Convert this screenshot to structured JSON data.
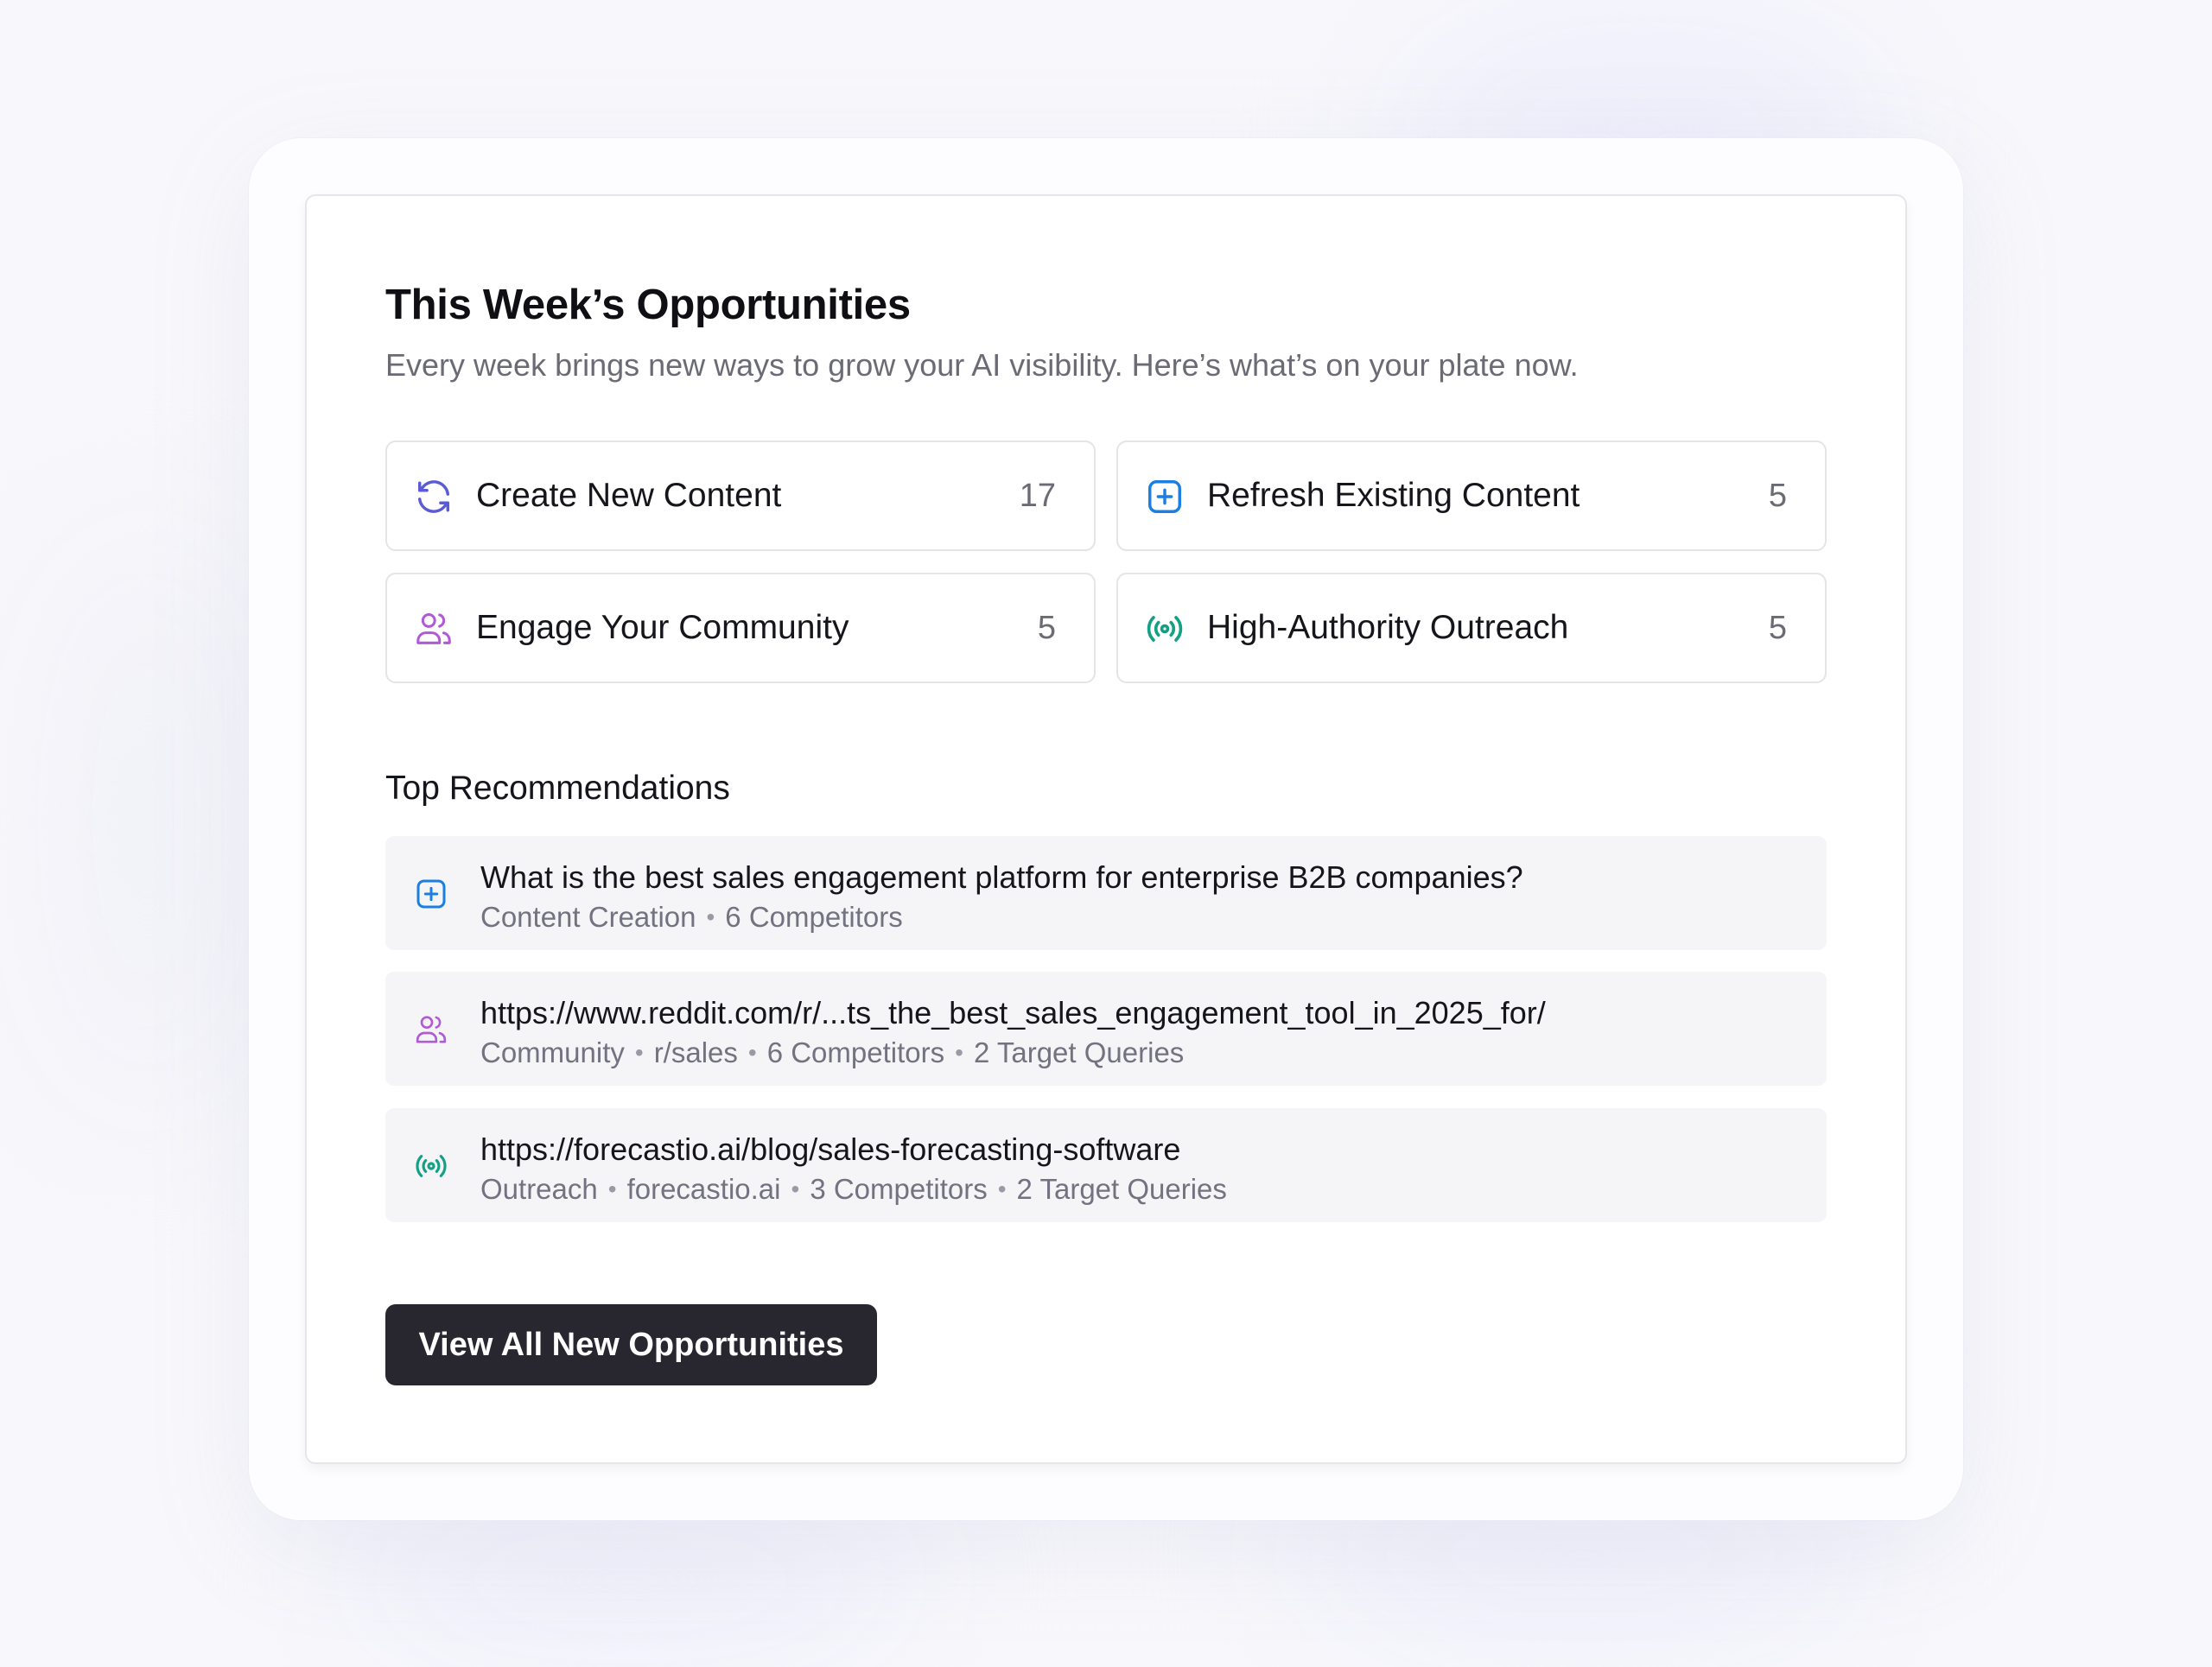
{
  "header": {
    "title": "This Week’s Opportunities",
    "subtitle": "Every week brings new ways to grow your AI visibility. Here’s what’s on your plate now."
  },
  "opportunities": [
    {
      "label": "Create New Content",
      "count": "17",
      "icon": "refresh-cycle-icon",
      "color": "#5b5bd6"
    },
    {
      "label": "Refresh Existing Content",
      "count": "5",
      "icon": "plus-square-icon",
      "color": "#1a7fe0"
    },
    {
      "label": "Engage Your Community",
      "count": "5",
      "icon": "users-icon",
      "color": "#b15ad6"
    },
    {
      "label": "High-Authority Outreach",
      "count": "5",
      "icon": "broadcast-icon",
      "color": "#14a085"
    }
  ],
  "recommendations": {
    "title": "Top Recommendations",
    "items": [
      {
        "title": "What is the best sales engagement platform for enterprise B2B companies?",
        "meta": [
          "Content Creation",
          "6 Competitors"
        ],
        "icon": "plus-square-icon"
      },
      {
        "title": "https://www.reddit.com/r/...ts_the_best_sales_engagement_tool_in_2025_for/",
        "meta": [
          "Community",
          "r/sales",
          "6 Competitors",
          "2 Target Queries"
        ],
        "icon": "users-icon"
      },
      {
        "title": "https://forecastio.ai/blog/sales-forecasting-software",
        "meta": [
          "Outreach",
          "forecastio.ai",
          "3 Competitors",
          "2 Target Queries"
        ],
        "icon": "broadcast-icon"
      }
    ]
  },
  "cta": {
    "label": "View All New Opportunities",
    "color": "#28262f"
  }
}
